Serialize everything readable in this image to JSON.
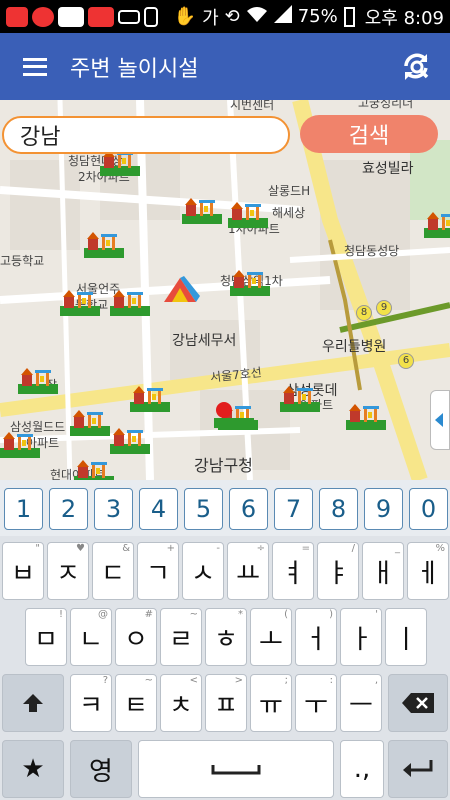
{
  "status_bar": {
    "left_icons": [
      "notification-icon-1",
      "notification-icon-2",
      "app-icon-1",
      "app-icon-2",
      "keyboard-icon",
      "battery-saver-icon"
    ],
    "ime_indicator": "가",
    "battery_percent": "75%",
    "time": "오후 8:09"
  },
  "app_bar": {
    "title": "주변 놀이시설"
  },
  "search": {
    "value": "강남",
    "button_label": "검색"
  },
  "map": {
    "labels": {
      "top_center": "시번센터",
      "top_right": "고궁성리더",
      "chungdam_apt": "청담현대상",
      "chungdam_apt2": "2차아파트",
      "hyosung": "효성빌라",
      "samrongdong": "살롱드H",
      "haenggong": "해세상",
      "apt1": "1차아파트",
      "school": "고등학교",
      "chungdam_church": "청담동성당",
      "seoul_inju": "서울언주",
      "chodeung": "초등학교",
      "cheongdam1": "청담삼익1차",
      "gangnam_tax": "강남세무서",
      "uridul": "우리들병원",
      "seoul7": "서울7호선",
      "samsung_lotte": "삼성롯데",
      "apt_right": "아파트",
      "samsung_world": "삼성월드드",
      "apt_left": "아파트",
      "gangnam_gu": "강남구청",
      "hyundai": "현대아파트",
      "station8": "8",
      "station9": "9",
      "station6": "6",
      "left_edge": "잡"
    }
  },
  "keyboard": {
    "numbers": [
      "1",
      "2",
      "3",
      "4",
      "5",
      "6",
      "7",
      "8",
      "9",
      "0"
    ],
    "row1": [
      {
        "label": "ㅂ",
        "sub": "\""
      },
      {
        "label": "ㅈ",
        "sub": "♥"
      },
      {
        "label": "ㄷ",
        "sub": "&"
      },
      {
        "label": "ㄱ",
        "sub": "+"
      },
      {
        "label": "ㅅ",
        "sub": "-"
      },
      {
        "label": "ㅛ",
        "sub": "÷"
      },
      {
        "label": "ㅕ",
        "sub": "="
      },
      {
        "label": "ㅑ",
        "sub": "/"
      },
      {
        "label": "ㅐ",
        "sub": "_"
      },
      {
        "label": "ㅔ",
        "sub": "%"
      }
    ],
    "row2": [
      {
        "label": "ㅁ",
        "sub": "!"
      },
      {
        "label": "ㄴ",
        "sub": "@"
      },
      {
        "label": "ㅇ",
        "sub": "#"
      },
      {
        "label": "ㄹ",
        "sub": "~"
      },
      {
        "label": "ㅎ",
        "sub": "*"
      },
      {
        "label": "ㅗ",
        "sub": "("
      },
      {
        "label": "ㅓ",
        "sub": ")"
      },
      {
        "label": "ㅏ",
        "sub": "'"
      },
      {
        "label": "ㅣ",
        "sub": ""
      }
    ],
    "row3": [
      {
        "label": "ㅋ",
        "sub": "?"
      },
      {
        "label": "ㅌ",
        "sub": "~"
      },
      {
        "label": "ㅊ",
        "sub": "<"
      },
      {
        "label": "ㅍ",
        "sub": ">"
      },
      {
        "label": "ㅠ",
        "sub": ";"
      },
      {
        "label": "ㅜ",
        "sub": ":"
      },
      {
        "label": "ㅡ",
        "sub": ","
      }
    ],
    "lang_key": "영",
    "star_key": "★",
    "punct_key": ".,"
  }
}
